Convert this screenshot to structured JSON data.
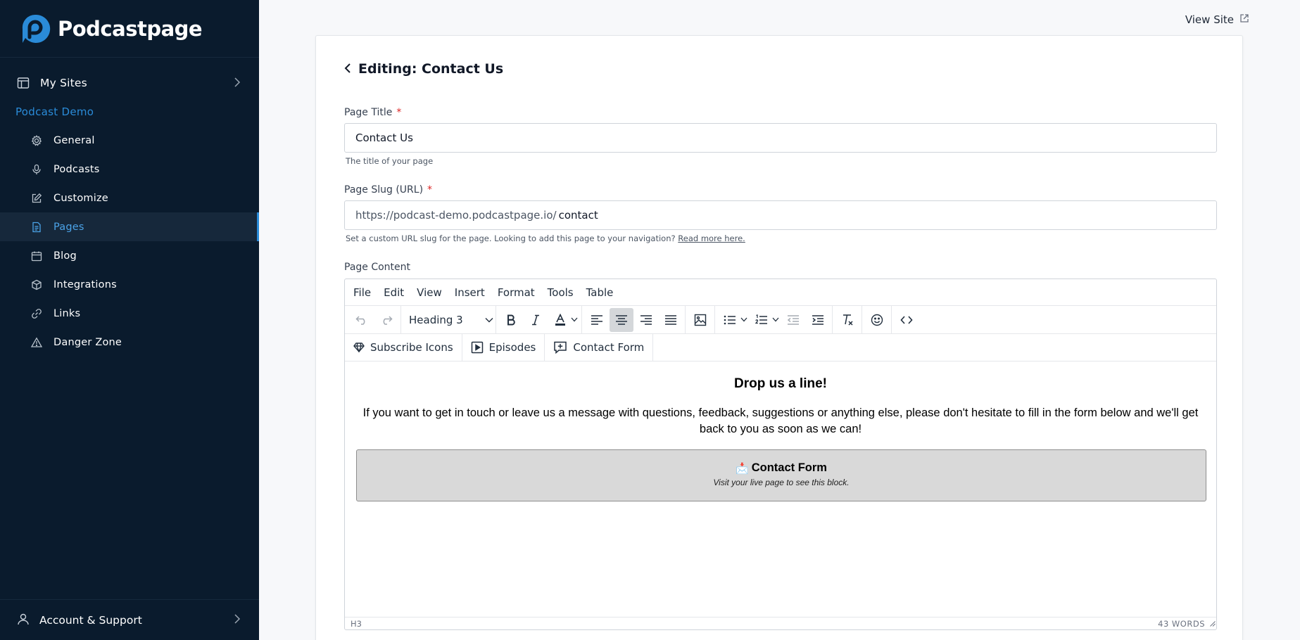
{
  "brand": {
    "name": "Podcastpage",
    "color": "#2a8bd8"
  },
  "sidebar": {
    "my_sites": "My Sites",
    "section": "Podcast Demo",
    "items": [
      {
        "label": "General",
        "icon": "gear-icon"
      },
      {
        "label": "Podcasts",
        "icon": "microphone-icon"
      },
      {
        "label": "Customize",
        "icon": "edit-icon"
      },
      {
        "label": "Pages",
        "icon": "page-icon",
        "active": true
      },
      {
        "label": "Blog",
        "icon": "calendar-icon"
      },
      {
        "label": "Integrations",
        "icon": "cube-icon"
      },
      {
        "label": "Links",
        "icon": "link-icon"
      },
      {
        "label": "Danger Zone",
        "icon": "warning-icon"
      }
    ],
    "account": "Account & Support"
  },
  "header": {
    "view_site": "View Site"
  },
  "editing": {
    "title": "Editing: Contact Us"
  },
  "form": {
    "page_title": {
      "label": "Page Title",
      "required": "*",
      "value": "Contact Us",
      "help": "The title of your page"
    },
    "slug": {
      "label": "Page Slug (URL)",
      "required": "*",
      "prefix": "https://podcast-demo.podcastpage.io/",
      "value": "contact",
      "help": "Set a custom URL slug for the page. Looking to add this page to your navigation?",
      "help_link": "Read more here."
    },
    "content_label": "Page Content"
  },
  "editor": {
    "menu": [
      "File",
      "Edit",
      "View",
      "Insert",
      "Format",
      "Tools",
      "Table"
    ],
    "block_format": "Heading 3",
    "custom_buttons": [
      "Subscribe Icons",
      "Episodes",
      "Contact Form"
    ],
    "content": {
      "heading": "Drop us a line!",
      "paragraph": "If you want to get in touch or leave us a message with questions, feedback, suggestions or anything else, please don't hesitate to fill in the form below and we'll get back to you as soon as we can!",
      "block_emoji": "📩",
      "block_title": "Contact Form",
      "block_subtitle": "Visit your live page to see this block."
    },
    "status": {
      "path": "H3",
      "word_count": "43 WORDS"
    }
  }
}
